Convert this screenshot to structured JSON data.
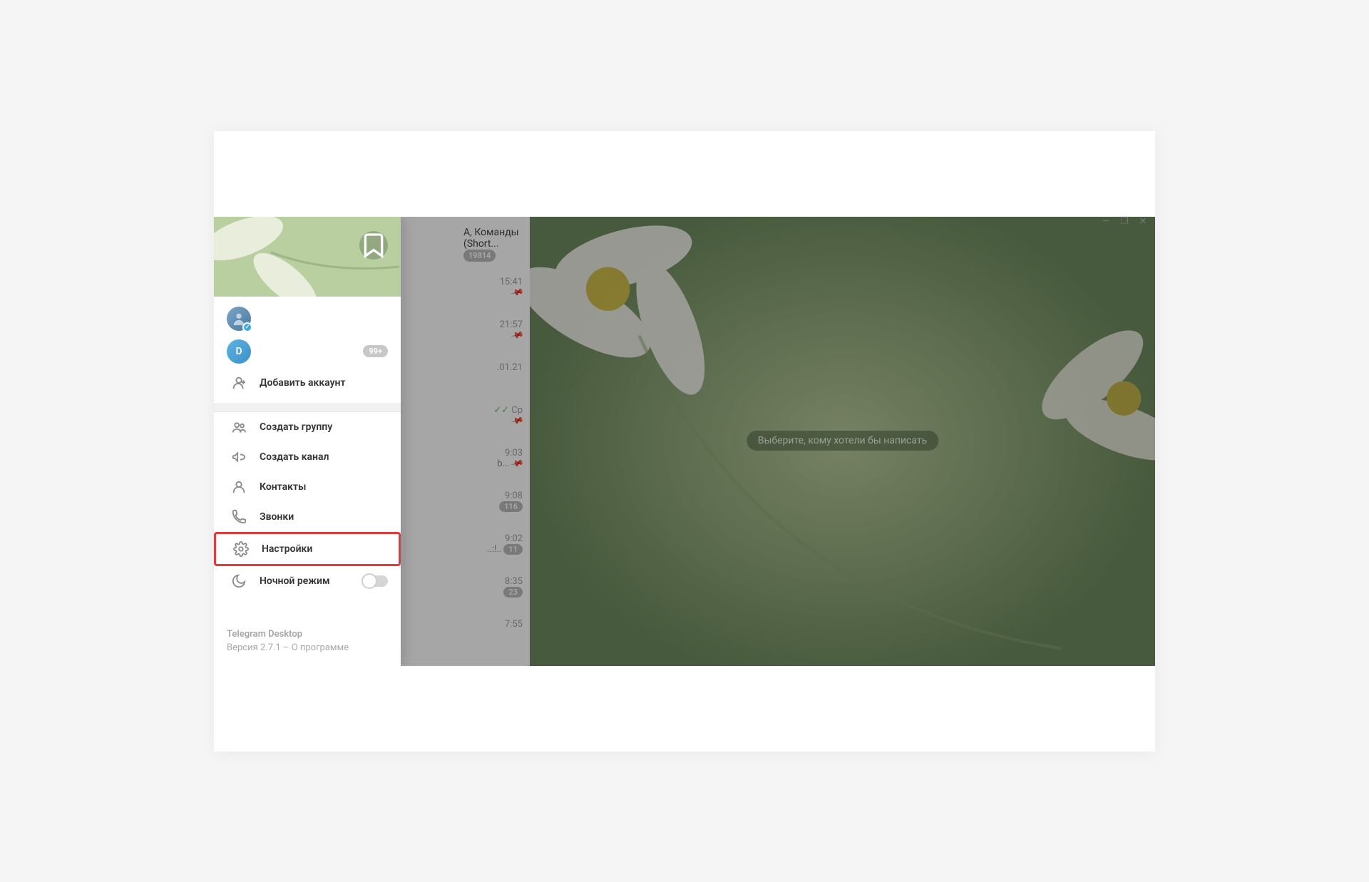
{
  "window_controls": {
    "minimize": "—",
    "maximize": "❐",
    "close": "✕"
  },
  "chat_top": {
    "title": "А, Команды (Short...",
    "badge": "19814"
  },
  "chat_items": [
    {
      "time": "15:41",
      "pin": true
    },
    {
      "time": "21:57",
      "pin": true
    },
    {
      "time": ".01.21",
      "pin": false
    },
    {
      "time": "Ср",
      "pin": true,
      "checks": true
    },
    {
      "time": "9:03",
      "pin": true,
      "sub": "b..."
    },
    {
      "time": "9:08",
      "badge": "116"
    },
    {
      "time": "9:02",
      "badge": "11",
      "sub": "..:!.."
    },
    {
      "time": "8:35",
      "badge": "23"
    },
    {
      "time": "7:55"
    }
  ],
  "main_placeholder": "Выберите, кому хотели бы написать",
  "drawer": {
    "accounts": [
      {
        "type": "photo",
        "verified": true
      },
      {
        "type": "letter",
        "letter": "D",
        "badge": "99+"
      }
    ],
    "add_account": "Добавить аккаунт",
    "menu": {
      "new_group": "Создать группу",
      "new_channel": "Создать канал",
      "contacts": "Контакты",
      "calls": "Звонки",
      "settings": "Настройки",
      "night_mode": "Ночной режим"
    },
    "footer": {
      "app_name": "Telegram Desktop",
      "version_line": "Версия 2.7.1 – О программе"
    }
  }
}
